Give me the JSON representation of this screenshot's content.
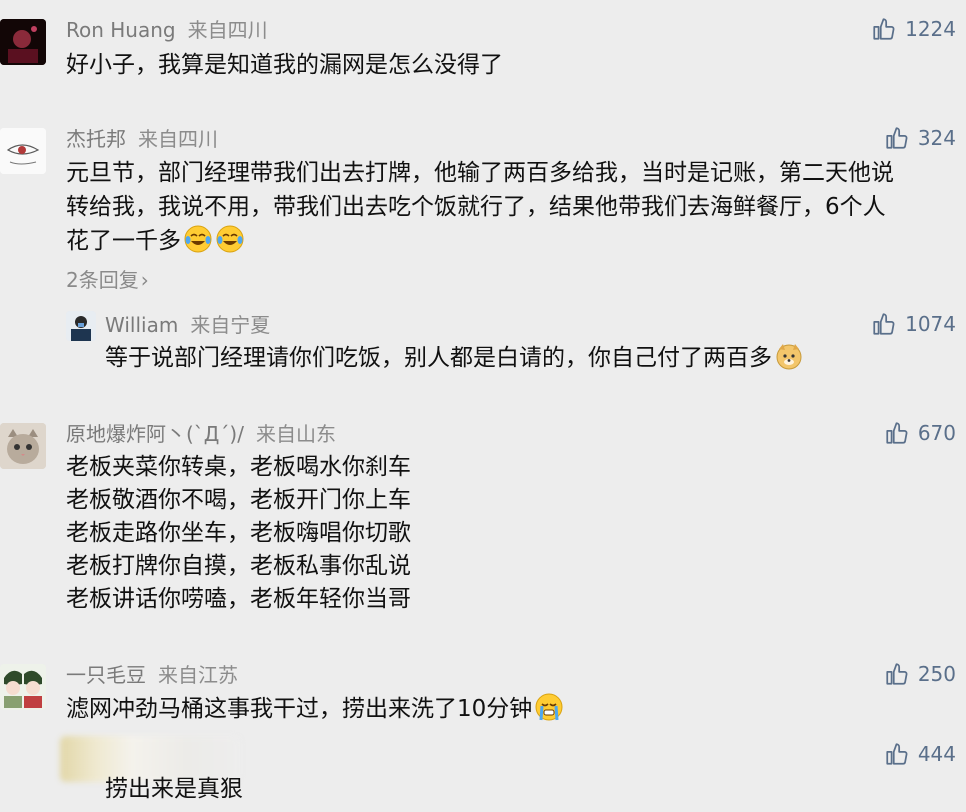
{
  "comments": [
    {
      "user": "Ron Huang",
      "location": "来自四川",
      "likes": "1224",
      "text": [
        "好小子，我算是知道我的漏网是怎么没得了"
      ]
    },
    {
      "user": "杰托邦",
      "location": "来自四川",
      "likes": "324",
      "text": [
        "元旦节，部门经理带我们出去打牌，他输了两百多给我，当时是记账，第二天他说",
        "转给我，我说不用，带我们出去吃个饭就行了，结果他带我们去海鲜餐厅，6个人",
        "花了一千多"
      ],
      "replies_label": "2条回复",
      "reply": {
        "user": "William",
        "location": "来自宁夏",
        "likes": "1074",
        "text": "等于说部门经理请你们吃饭，别人都是白请的，你自己付了两百多"
      }
    },
    {
      "user": "原地爆炸阿丶(`Д´)/",
      "location": "来自山东",
      "likes": "670",
      "text": [
        "老板夹菜你转桌，老板喝水你刹车",
        "老板敬酒你不喝，老板开门你上车",
        "老板走路你坐车，老板嗨唱你切歌",
        "老板打牌你自摸，老板私事你乱说",
        "老板讲话你唠嗑，老板年轻你当哥"
      ]
    },
    {
      "user": "一只毛豆",
      "location": "来自江苏",
      "likes": "250",
      "text": [
        "滤网冲劲马桶这事我干过，捞出来洗了10分钟"
      ],
      "reply": {
        "likes": "444",
        "text": "捞出来是真狠"
      }
    }
  ],
  "icons": {
    "like": "thumbs-up-icon",
    "chevron": "chevron-right-icon"
  },
  "colors": {
    "background": "#ededed",
    "like": "#5a6f8a",
    "username": "#7a7a7a"
  }
}
